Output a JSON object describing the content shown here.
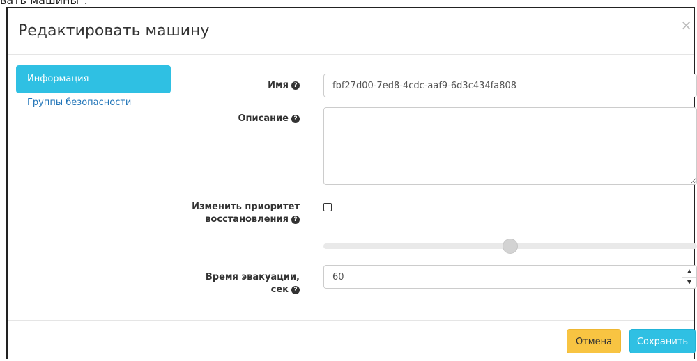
{
  "page": {
    "cutoff_text": "вать машины\":"
  },
  "modal": {
    "title": "Редактировать машину",
    "close_symbol": "×"
  },
  "nav": {
    "items": [
      {
        "label": "Информация",
        "active": true
      },
      {
        "label": "Группы безопасности",
        "active": false
      }
    ]
  },
  "form": {
    "name": {
      "label": "Имя",
      "value": "fbf27d00-7ed8-4cdc-aaf9-6d3c434fa808"
    },
    "description": {
      "label": "Описание",
      "value": ""
    },
    "recovery_priority": {
      "label_line1": "Изменить приоритет",
      "label_line2": "восстановления",
      "checked": false,
      "slider_level": 0.5
    },
    "evacuation_time": {
      "label_line1": "Время эвакуации,",
      "label_line2": "сек",
      "value": "60"
    },
    "help_icon": "?"
  },
  "footer": {
    "cancel_label": "Отмена",
    "save_label": "Сохранить"
  },
  "colors": {
    "accent": "#2fc0e3",
    "cancel": "#f8c442",
    "link": "#1f73b7"
  }
}
